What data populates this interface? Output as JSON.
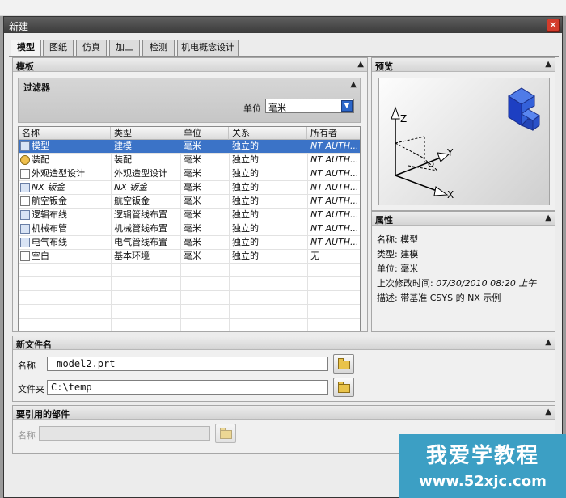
{
  "window": {
    "title": "新建",
    "close_glyph": "✕"
  },
  "tabs": [
    {
      "label": "模型",
      "active": true
    },
    {
      "label": "图纸",
      "active": false
    },
    {
      "label": "仿真",
      "active": false
    },
    {
      "label": "加工",
      "active": false
    },
    {
      "label": "检测",
      "active": false
    },
    {
      "label": "机电概念设计",
      "active": false
    }
  ],
  "templates": {
    "title": "模板",
    "filter": {
      "title": "过滤器",
      "unit_label": "单位",
      "unit_value": "毫米"
    },
    "columns": [
      "名称",
      "类型",
      "单位",
      "关系",
      "所有者"
    ],
    "rows": [
      {
        "name": "模型",
        "type": "建模",
        "unit": "毫米",
        "relation": "独立的",
        "owner": "NT AUTH...",
        "icon": "model-icon",
        "selected": true
      },
      {
        "name": "装配",
        "type": "装配",
        "unit": "毫米",
        "relation": "独立的",
        "owner": "NT AUTH...",
        "icon": "assembly-icon"
      },
      {
        "name": "外观造型设计",
        "type": "外观造型设计",
        "unit": "毫米",
        "relation": "独立的",
        "owner": "NT AUTH...",
        "icon": "shape-studio-icon"
      },
      {
        "name": "NX 钣金",
        "type": "NX 钣金",
        "unit": "毫米",
        "relation": "独立的",
        "owner": "NT AUTH...",
        "icon": "sheet-metal-icon"
      },
      {
        "name": "航空钣金",
        "type": "航空钣金",
        "unit": "毫米",
        "relation": "独立的",
        "owner": "NT AUTH...",
        "icon": "aero-sheet-metal-icon"
      },
      {
        "name": "逻辑布线",
        "type": "逻辑管线布置",
        "unit": "毫米",
        "relation": "独立的",
        "owner": "NT AUTH...",
        "icon": "logical-routing-icon"
      },
      {
        "name": "机械布管",
        "type": "机械管线布置",
        "unit": "毫米",
        "relation": "独立的",
        "owner": "NT AUTH...",
        "icon": "mechanical-routing-icon"
      },
      {
        "name": "电气布线",
        "type": "电气管线布置",
        "unit": "毫米",
        "relation": "独立的",
        "owner": "NT AUTH...",
        "icon": "electrical-routing-icon"
      },
      {
        "name": "空白",
        "type": "基本环境",
        "unit": "毫米",
        "relation": "独立的",
        "owner": "无",
        "icon": "blank-document-icon"
      }
    ]
  },
  "preview": {
    "title": "预览",
    "axis_labels": {
      "x": "X",
      "y": "Y",
      "z": "Z"
    }
  },
  "properties": {
    "title": "属性",
    "items": [
      {
        "label": "名称:",
        "value": "模型"
      },
      {
        "label": "类型:",
        "value": "建模"
      },
      {
        "label": "单位:",
        "value": "毫米"
      },
      {
        "label": "上次修改时间:",
        "value": "07/30/2010 08:20 上午"
      },
      {
        "label": "描述:",
        "value": "带基准 CSYS 的 NX 示例"
      }
    ]
  },
  "new_file": {
    "title": "新文件名",
    "name_label": "名称",
    "name_value": "_model2.prt",
    "folder_label": "文件夹",
    "folder_value": "C:\\temp"
  },
  "referenced_part": {
    "title": "要引用的部件",
    "name_label": "名称",
    "name_value": ""
  },
  "watermark": {
    "line1": "我爱学教程",
    "line2": "www.52xjc.com"
  },
  "colors": {
    "selection": "#3b73c7",
    "watermark": "#3c9fc4",
    "titlebar": "#4a4a4a"
  }
}
